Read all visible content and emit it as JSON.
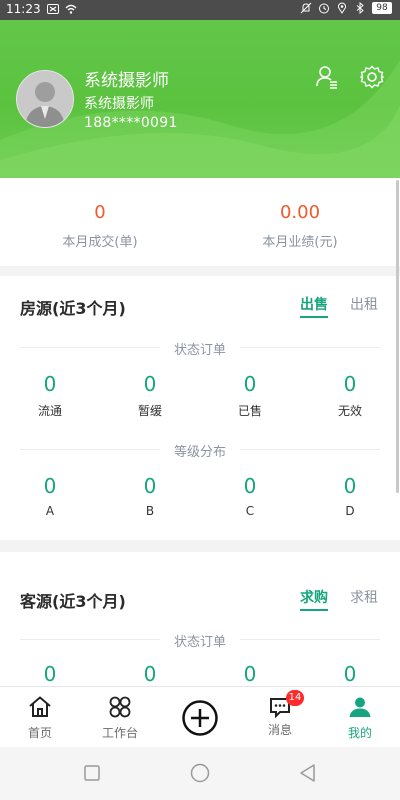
{
  "status_bar": {
    "time": "11:23",
    "battery": "98"
  },
  "profile": {
    "name": "系统摄影师",
    "role": "系统摄影师",
    "phone": "188****0091"
  },
  "monthly": [
    {
      "value": "0",
      "label": "本月成交(单)"
    },
    {
      "value": "0.00",
      "label": "本月业绩(元)"
    }
  ],
  "houses": {
    "title": "房源(近3个月)",
    "tabs": [
      {
        "label": "出售",
        "active": true
      },
      {
        "label": "出租",
        "active": false
      }
    ],
    "status_heading": "状态订单",
    "status": [
      {
        "value": "0",
        "label": "流通"
      },
      {
        "value": "0",
        "label": "暂缓"
      },
      {
        "value": "0",
        "label": "已售"
      },
      {
        "value": "0",
        "label": "无效"
      }
    ],
    "grade_heading": "等级分布",
    "grades": [
      {
        "value": "0",
        "label": "A"
      },
      {
        "value": "0",
        "label": "B"
      },
      {
        "value": "0",
        "label": "C"
      },
      {
        "value": "0",
        "label": "D"
      }
    ]
  },
  "customers": {
    "title": "客源(近3个月)",
    "tabs": [
      {
        "label": "求购",
        "active": true
      },
      {
        "label": "求租",
        "active": false
      }
    ],
    "status_heading": "状态订单",
    "status": [
      {
        "value": "0"
      },
      {
        "value": "0"
      },
      {
        "value": "0"
      },
      {
        "value": "0"
      }
    ]
  },
  "bottom_nav": {
    "items": [
      {
        "label": "首页",
        "icon": "home-icon"
      },
      {
        "label": "工作台",
        "icon": "workbench-icon"
      },
      {
        "label": "",
        "icon": "plus-circle-icon"
      },
      {
        "label": "消息",
        "icon": "message-icon",
        "badge": "14"
      },
      {
        "label": "我的",
        "icon": "person-icon",
        "active": true
      }
    ]
  },
  "colors": {
    "accent": "#17a57f",
    "header_green": "#5bc23f",
    "stat_value": "#f05a2b",
    "badge": "#ff2b2b"
  }
}
